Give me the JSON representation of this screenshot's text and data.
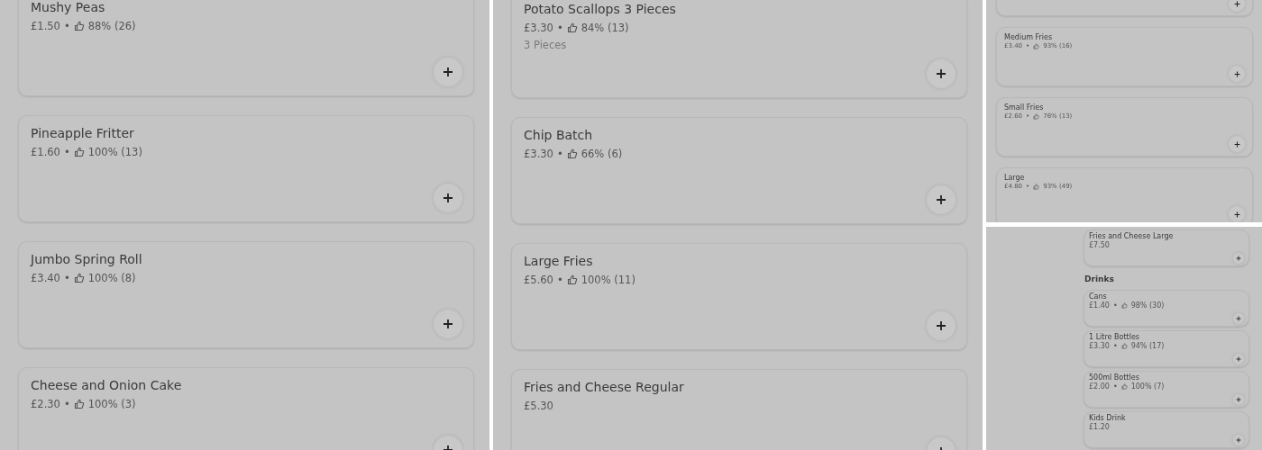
{
  "panels": [
    {
      "items": [
        {
          "kind": "dish",
          "name": "Mushy Peas",
          "price": "£1.50",
          "separator": "•",
          "rating": "88% (26)"
        },
        {
          "kind": "dish",
          "name": "Pineapple Fritter",
          "price": "£1.60",
          "separator": "•",
          "rating": "100% (13)"
        },
        {
          "kind": "dish",
          "name": "Jumbo Spring Roll",
          "price": "£3.40",
          "separator": "•",
          "rating": "100% (8)"
        },
        {
          "kind": "dish",
          "name": "Cheese and Onion Cake",
          "price": "£2.30",
          "separator": "•",
          "rating": "100% (3)"
        }
      ]
    },
    {
      "items": [
        {
          "kind": "dish",
          "name": "Potato Scallops 3 Pieces",
          "price": "£3.30",
          "separator": "•",
          "rating": "84% (13)",
          "description": "3 Pieces"
        },
        {
          "kind": "dish",
          "name": "Chip Batch",
          "price": "£3.30",
          "separator": "•",
          "rating": "66% (6)"
        },
        {
          "kind": "dish",
          "name": "Large Fries",
          "price": "£5.60",
          "separator": "•",
          "rating": "100% (11)"
        },
        {
          "kind": "dish",
          "name": "Fries and Cheese Regular",
          "price": "£5.30"
        }
      ]
    },
    {
      "items": [
        {
          "kind": "dish"
        },
        {
          "kind": "dish",
          "name": "Medium Fries",
          "price": "£3.40",
          "separator": "•",
          "rating": "93% (16)"
        },
        {
          "kind": "dish",
          "name": "Small Fries",
          "price": "£2.60",
          "separator": "•",
          "rating": "76% (13)"
        },
        {
          "kind": "dish",
          "name": "Large",
          "price": "£4.80",
          "separator": "•",
          "rating": "93% (49)"
        }
      ]
    },
    {
      "items": [
        {
          "kind": "dish",
          "name": "Fries and Cheese Large",
          "price": "£7.50"
        },
        {
          "kind": "heading",
          "name": "Drinks"
        },
        {
          "kind": "dish",
          "name": "Cans",
          "price": "£1.40",
          "separator": "•",
          "rating": "98% (30)"
        },
        {
          "kind": "dish",
          "name": "1 Litre Bottles",
          "price": "£3.30",
          "separator": "•",
          "rating": "94% (17)"
        },
        {
          "kind": "dish",
          "name": "500ml Bottles",
          "price": "£2.00",
          "separator": "•",
          "rating": "100% (7)"
        },
        {
          "kind": "dish",
          "name": "Kids Drink",
          "price": "£1.20"
        }
      ]
    }
  ]
}
